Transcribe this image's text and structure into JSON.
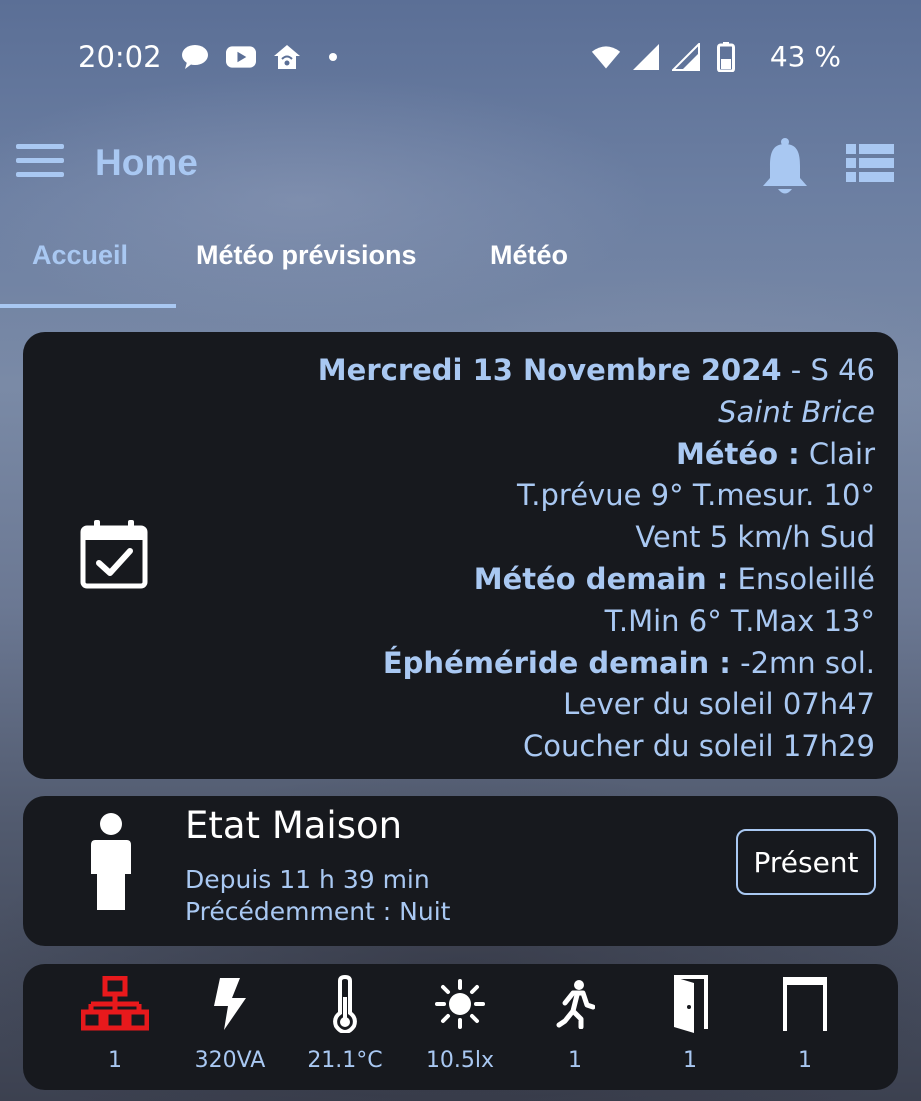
{
  "status_bar": {
    "time": "20:02",
    "battery": "43 %",
    "left_icons": [
      "chat-icon",
      "youtube-icon",
      "home-wifi-icon",
      "dot-icon"
    ],
    "right_icons": [
      "wifi-icon",
      "signal-icon",
      "signal-icon",
      "battery-icon"
    ]
  },
  "app_bar": {
    "title": "Home",
    "accent_color": "#a9c8f2"
  },
  "tabs": [
    {
      "label": "Accueil",
      "active": true
    },
    {
      "label": "Météo prévisions",
      "active": false
    },
    {
      "label": "Météo",
      "active": false
    }
  ],
  "calendar_card": {
    "icon": "calendar-check-icon",
    "date_bold": "Mercredi 13 Novembre 2024",
    "week": " - S 46",
    "location": "Saint Brice",
    "weather_label": "Météo :",
    "weather_value": " Clair",
    "temps": "T.prévue 9° T.mesur. 10°",
    "wind": "Vent 5 km/h Sud",
    "tomorrow_label": "Météo demain :",
    "tomorrow_value": " Ensoleillé",
    "tomorrow_temps": "T.Min 6° T.Max 13° ",
    "ephem_label": "Éphéméride demain :",
    "ephem_value": " -2mn sol.",
    "sunrise": "Lever du soleil 07h47",
    "sunset": "Coucher du soleil 17h29"
  },
  "house_card": {
    "icon": "person-icon",
    "title": "Etat Maison",
    "since": "Depuis 11 h 39 min",
    "previous": "Précédemment : Nuit",
    "status_button": "Présent"
  },
  "sensors": [
    {
      "icon": "network-icon",
      "value": "1",
      "color": "#e8191c"
    },
    {
      "icon": "lightning-icon",
      "value": "320VA",
      "color": "#ffffff"
    },
    {
      "icon": "thermometer-icon",
      "value": "21.1°C",
      "color": "#ffffff"
    },
    {
      "icon": "sun-icon",
      "value": "10.5lx",
      "color": "#ffffff"
    },
    {
      "icon": "walking-person-icon",
      "value": "1",
      "color": "#ffffff"
    },
    {
      "icon": "door-open-icon",
      "value": "1",
      "color": "#ffffff"
    },
    {
      "icon": "garage-door-icon",
      "value": "1",
      "color": "#ffffff"
    }
  ]
}
